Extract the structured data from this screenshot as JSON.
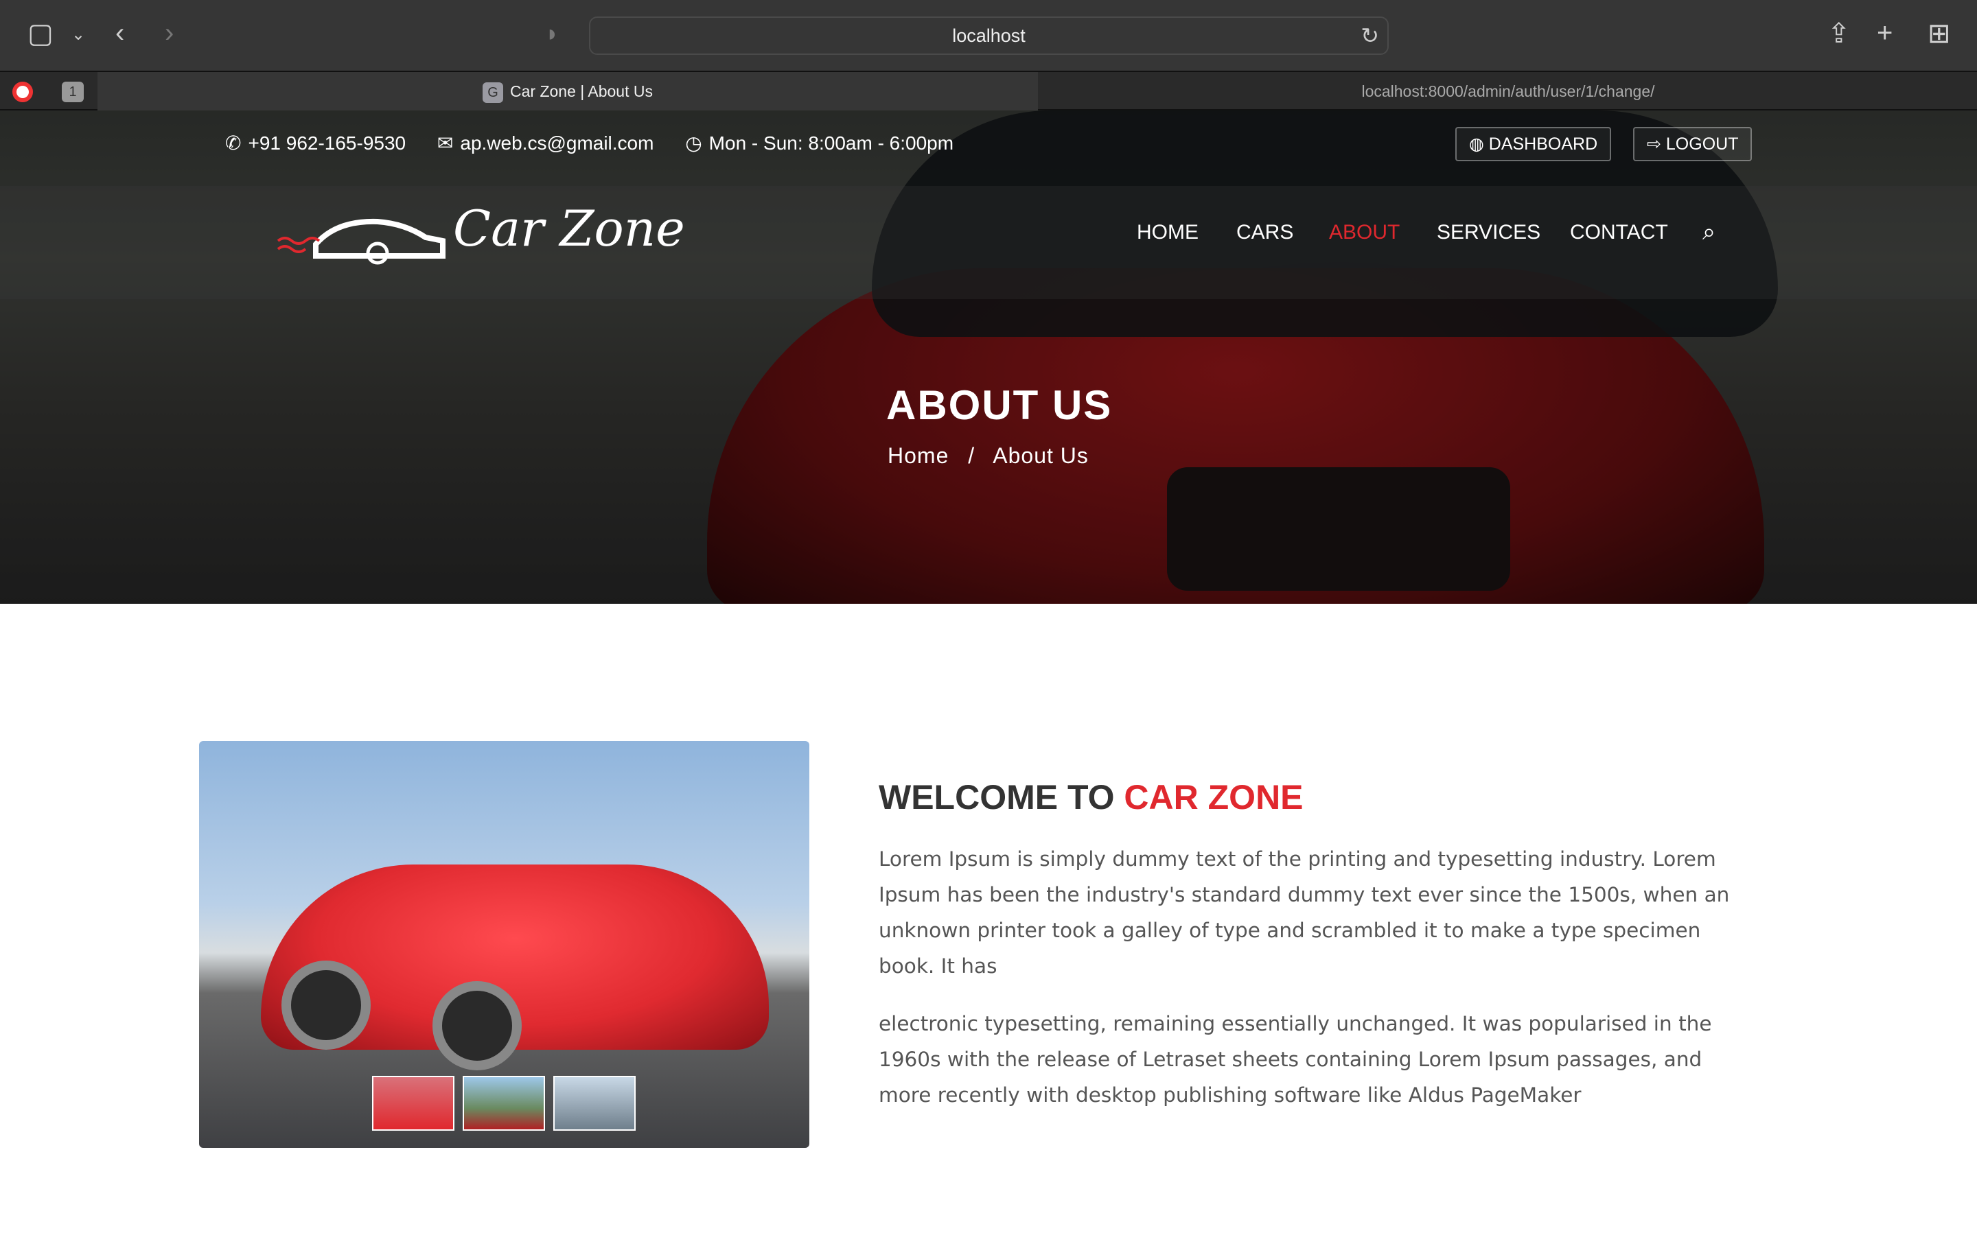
{
  "browser": {
    "url": "localhost",
    "tabs": [
      {
        "label": "Car Zone | About Us",
        "favicon": "G"
      },
      {
        "label": "localhost:8000/admin/auth/user/1/change/"
      }
    ],
    "pinned_count": "1"
  },
  "topbar": {
    "phone": "+91 962-165-9530",
    "email": "ap.web.cs@gmail.com",
    "hours": "Mon - Sun: 8:00am - 6:00pm",
    "dashboard": "DASHBOARD",
    "logout": "LOGOUT"
  },
  "logo": {
    "text": "Car Zone"
  },
  "nav": {
    "items": [
      "HOME",
      "CARS",
      "ABOUT",
      "SERVICES",
      "CONTACT"
    ],
    "active": "ABOUT",
    "accent": "#e0282e"
  },
  "hero": {
    "title": "ABOUT US",
    "crumb_home": "Home",
    "crumb_sep": "/",
    "crumb_current": "About Us"
  },
  "about": {
    "heading_prefix": "WELCOME TO",
    "heading_brand": "CAR ZONE",
    "p1": "Lorem Ipsum is simply dummy text of the printing and typesetting industry. Lorem Ipsum has been the industry's standard dummy text ever since the 1500s, when an unknown printer took a galley of type and scrambled it to make a type specimen book. It has",
    "p2": "electronic typesetting, remaining essentially unchanged. It was popularised in the 1960s with the release of Letraset sheets containing Lorem Ipsum passages, and more recently with desktop publishing software like Aldus PageMaker"
  }
}
